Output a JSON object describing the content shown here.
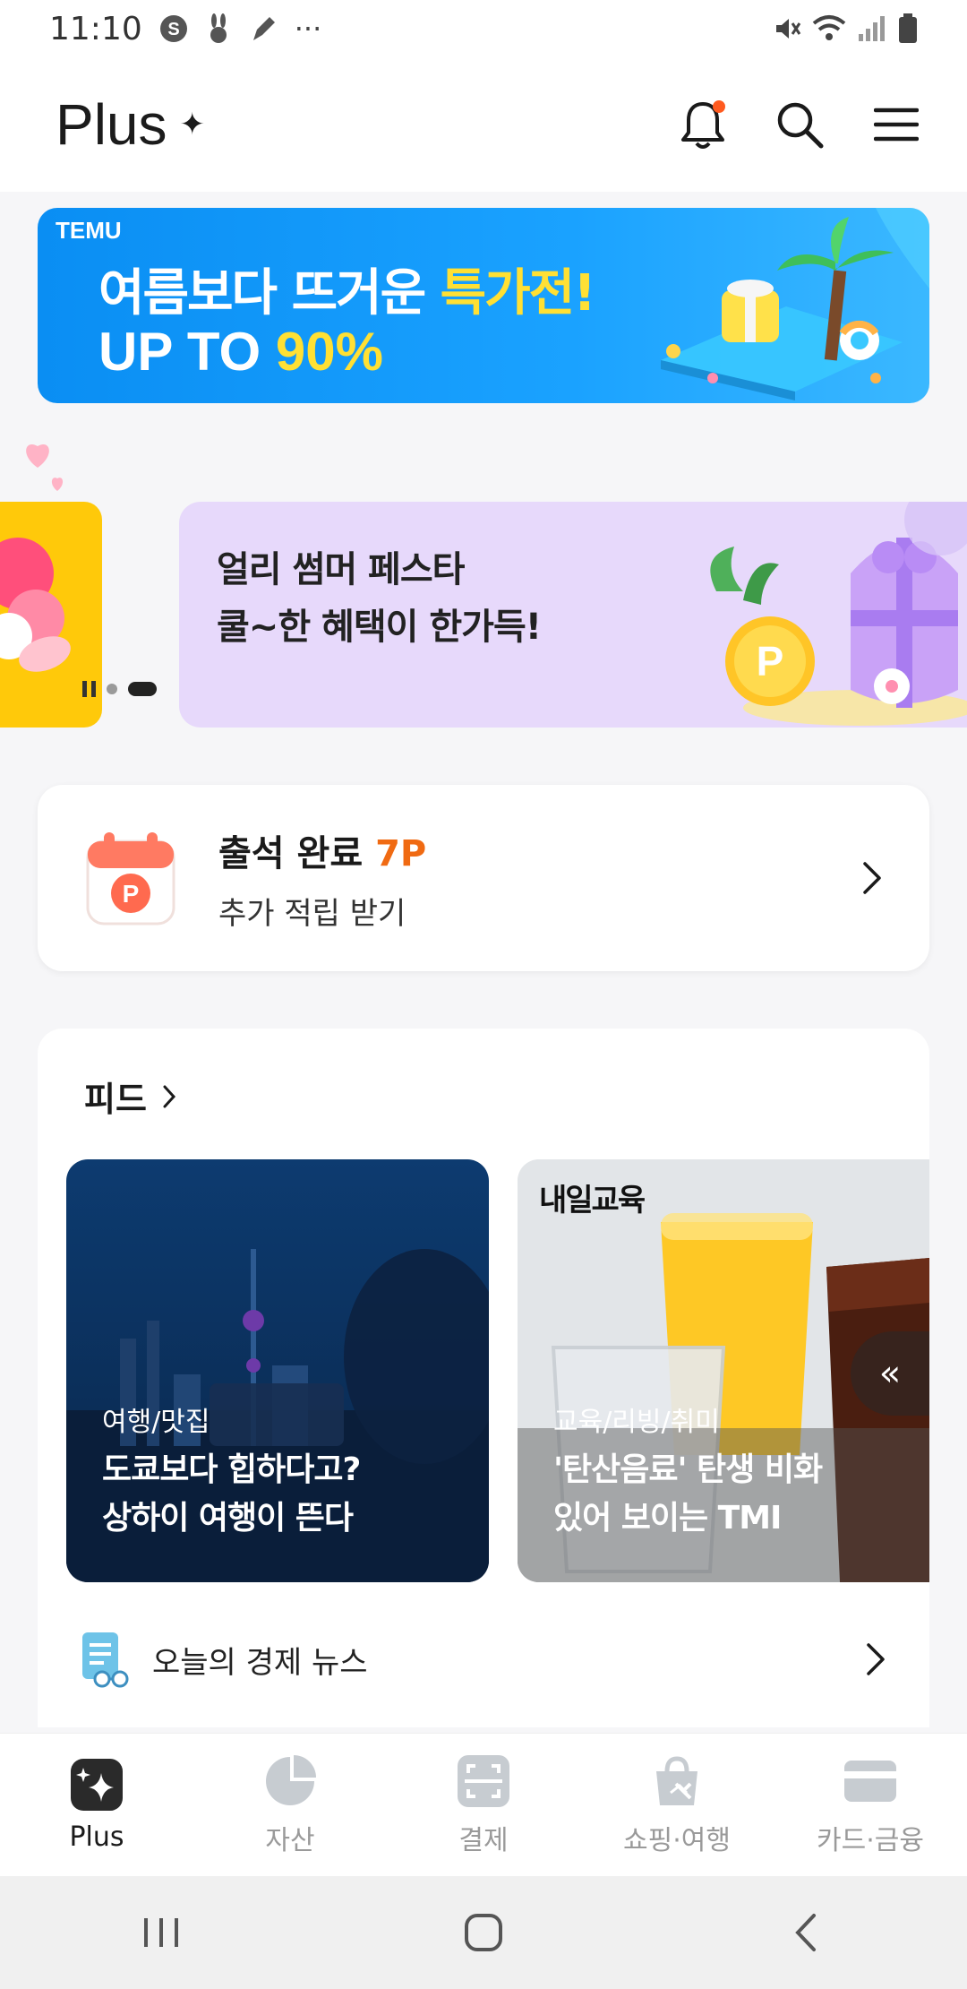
{
  "status_bar": {
    "time": "11:10",
    "left_icons": [
      "s-badge-icon",
      "rabbit-icon",
      "pen-icon",
      "more-dots-icon"
    ],
    "right_icons": [
      "mute-icon",
      "wifi-icon",
      "signal-icon",
      "battery-icon"
    ],
    "more": "···"
  },
  "header": {
    "logo_text": "Plus",
    "logo_star": "✦",
    "actions": [
      "bell-icon",
      "search-icon",
      "menu-icon"
    ],
    "has_notification": true
  },
  "temu_banner": {
    "brand": "TEMU",
    "line1_main": "여름보다 뜨거운 ",
    "line1_highlight": "특가전!",
    "line2_main": "UP TO ",
    "line2_highlight": "90%"
  },
  "promo": {
    "line1": "얼리 썸머 페스타",
    "line2": "쿨~한 혜택이 한가득!",
    "coin_label": "P",
    "active_slide_index": 1
  },
  "attendance": {
    "title": "출석 완료",
    "points": "7P",
    "subtitle": "추가 적립 받기",
    "calendar_label": "P"
  },
  "feed": {
    "title": "피드",
    "tiles": [
      {
        "category": "여행/맛집",
        "title_line1": "도쿄보다 힙하다고?",
        "title_line2": "상하이 여행이 뜬다"
      },
      {
        "brand": "내일교육",
        "category": "교육/리빙/취미",
        "title_line1": "'탄산음료' 탄생 비화",
        "title_line2": "있어 보이는 TMI"
      }
    ],
    "scroll_button": "«",
    "news_label": "오늘의 경제 뉴스"
  },
  "bottom_nav": {
    "items": [
      {
        "label": "Plus",
        "icon": "plus-sparkle-icon",
        "active": true
      },
      {
        "label": "자산",
        "icon": "pie-chart-icon",
        "active": false
      },
      {
        "label": "결제",
        "icon": "scan-icon",
        "active": false
      },
      {
        "label": "쇼핑·여행",
        "icon": "shopping-bag-icon",
        "active": false
      },
      {
        "label": "카드·금융",
        "icon": "credit-card-icon",
        "active": false
      }
    ]
  },
  "colors": {
    "accent_orange": "#f06a12",
    "temu_blue": "#1aa2ff",
    "temu_yellow": "#ffe034",
    "promo_purple": "#e7d9fb",
    "promo_yellow": "#ffc90a"
  }
}
